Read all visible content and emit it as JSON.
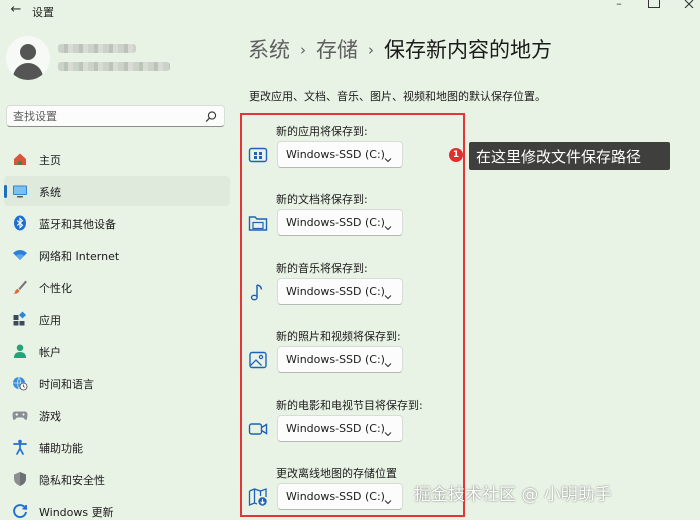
{
  "window": {
    "title": "设置",
    "minimize_glyph": "–"
  },
  "sidebar": {
    "search_placeholder": "查找设置",
    "items": [
      {
        "label": "主页",
        "icon": "home-icon",
        "active": false
      },
      {
        "label": "系统",
        "icon": "system-monitor-icon",
        "active": true
      },
      {
        "label": "蓝牙和其他设备",
        "icon": "bluetooth-icon",
        "active": false
      },
      {
        "label": "网络和 Internet",
        "icon": "wifi-icon",
        "active": false
      },
      {
        "label": "个性化",
        "icon": "paintbrush-icon",
        "active": false
      },
      {
        "label": "应用",
        "icon": "apps-icon",
        "active": false
      },
      {
        "label": "帐户",
        "icon": "account-icon",
        "active": false
      },
      {
        "label": "时间和语言",
        "icon": "globe-clock-icon",
        "active": false
      },
      {
        "label": "游戏",
        "icon": "gamepad-icon",
        "active": false
      },
      {
        "label": "辅助功能",
        "icon": "accessibility-icon",
        "active": false
      },
      {
        "label": "隐私和安全性",
        "icon": "shield-icon",
        "active": false
      },
      {
        "label": "Windows 更新",
        "icon": "windows-update-icon",
        "active": false
      }
    ]
  },
  "main": {
    "breadcrumb": [
      "系统",
      "存储",
      "保存新内容的地方"
    ],
    "breadcrumb_separator": "›",
    "description": "更改应用、文档、音乐、图片、视频和地图的默认保存位置。",
    "settings": [
      {
        "label": "新的应用将保存到:",
        "value": "Windows-SSD (C:)",
        "icon": "app-store-icon"
      },
      {
        "label": "新的文档将保存到:",
        "value": "Windows-SSD (C:)",
        "icon": "document-folder-icon"
      },
      {
        "label": "新的音乐将保存到:",
        "value": "Windows-SSD (C:)",
        "icon": "music-note-icon"
      },
      {
        "label": "新的照片和视频将保存到:",
        "value": "Windows-SSD (C:)",
        "icon": "picture-icon"
      },
      {
        "label": "新的电影和电视节目将保存到:",
        "value": "Windows-SSD (C:)",
        "icon": "video-camera-icon"
      },
      {
        "label": "更改离线地图的存储位置",
        "value": "Windows-SSD (C:)",
        "icon": "map-download-icon"
      }
    ]
  },
  "annotation": {
    "badge": "1",
    "text": "在这里修改文件保存路径",
    "frame_color": "#e33535"
  },
  "watermark": "掘金技术社区 @ 小明助手",
  "colors": {
    "background": "#e9f3e5",
    "accent": "#1d6fbf",
    "callout_bg": "#3f403e"
  }
}
